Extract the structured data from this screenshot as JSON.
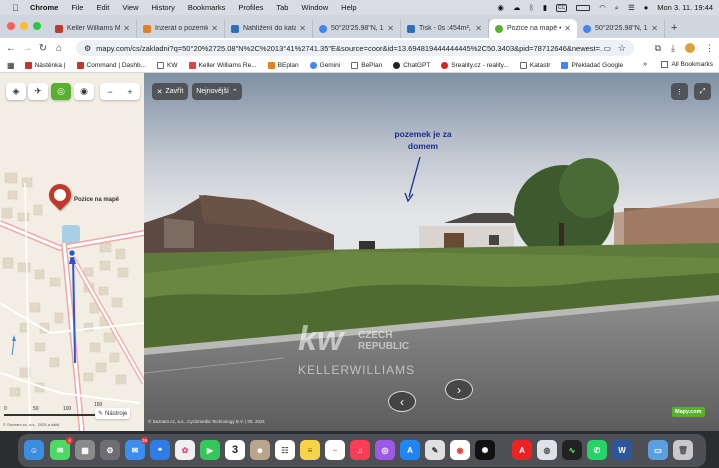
{
  "menubar": {
    "app": "Chrome",
    "items": [
      "File",
      "Edit",
      "View",
      "History",
      "Bookmarks",
      "Profiles",
      "Tab",
      "Window",
      "Help"
    ],
    "clock": "Mon 3. 11.  19:44"
  },
  "tabs": [
    {
      "label": "Keller Williams Me",
      "color": "#c0392b"
    },
    {
      "label": "Inzerát o pozemku",
      "color": "#e67e22"
    },
    {
      "label": "Nahlížení do katast",
      "color": "#2c6fbb"
    },
    {
      "label": "50°20'25.98\"N, 13",
      "color": "#4285f4"
    },
    {
      "label": "Tisk - 0s :454m², Č",
      "color": "#2c6fbb"
    },
    {
      "label": "Pozice na mapě • S",
      "color": "#59b02f",
      "active": true
    },
    {
      "label": "50°20'25.98\"N, 13",
      "color": "#4285f4"
    }
  ],
  "toolbar": {
    "url": "mapy.com/cs/zakladni?q=50°20%2725.08\"N%2C%2013°41%2741.35\"E&source=coor&id=13.694819444444445%2C50.3403&pid=78712646&newest=..."
  },
  "bookmarks": [
    {
      "label": "Nástěnka |",
      "color": "#c0392b"
    },
    {
      "label": "Command | Dashb...",
      "color": "#c0392b"
    },
    {
      "label": "KW",
      "color": "#666"
    },
    {
      "label": "Keller Williams Re...",
      "color": "#d44"
    },
    {
      "label": "BEplan",
      "color": "#e67e22"
    },
    {
      "label": "Gemini",
      "color": "#4285f4"
    },
    {
      "label": "BePlan",
      "color": "#666"
    },
    {
      "label": "ChatGPT",
      "color": "#222"
    },
    {
      "label": "Sreality.cz - reality...",
      "color": "#d22"
    },
    {
      "label": "Katastr",
      "color": "#666"
    },
    {
      "label": "Překladač Google",
      "color": "#4285f4"
    }
  ],
  "all_bookmarks": "All Bookmarks",
  "map": {
    "pin_label": "Pozice na mapě",
    "scale_labels": [
      "0",
      "50",
      "100",
      "150"
    ],
    "scale_unit": "m",
    "tools_label": "Nástroje",
    "copyright": "© Seznam.cz, a.s., 2025 a další"
  },
  "panorama": {
    "close_label": "Zavřít",
    "newest_label": "Nejnovější",
    "annotation": "pozemek je za domem",
    "watermark_kw": "kw",
    "watermark_country": "CZECH REPUBLIC",
    "watermark_brand": "KELLERWILLIAMS",
    "copyright": "© Seznam.cz, a.s., Cyclomedia Technology B.V. | 05. 2021",
    "logo": "Mapy.com"
  },
  "dock": {
    "date_day": "3",
    "badges": {
      "mail": "39",
      "messages": "4"
    }
  }
}
